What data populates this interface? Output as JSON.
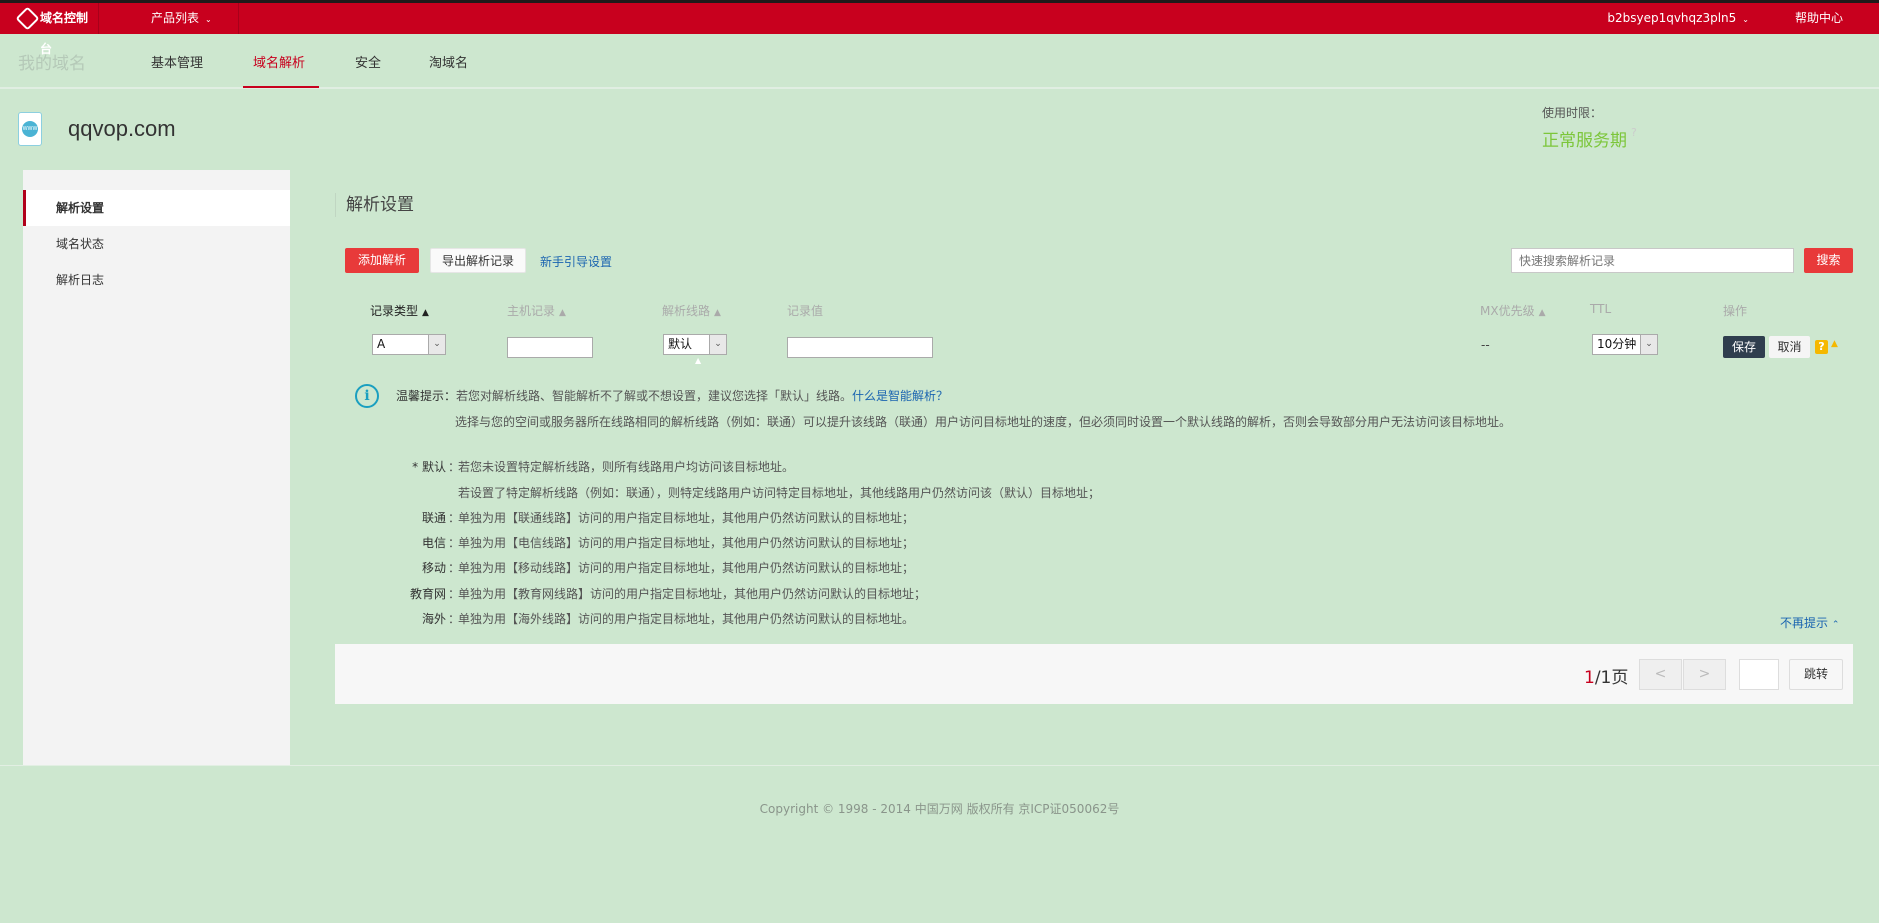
{
  "topbar": {
    "logo": "域名控制台",
    "products": "产品列表",
    "user": "b2bsyep1qvhqz3pln5",
    "help": "帮助中心"
  },
  "subnav": {
    "title": "我的域名",
    "items": [
      "基本管理",
      "域名解析",
      "安全",
      "淘域名"
    ],
    "active": "域名解析"
  },
  "domain": {
    "name": "qqvop.com",
    "usage_label": "使用时限：",
    "usage_status": "正常服务期"
  },
  "sidebar": {
    "items": [
      {
        "label": "解析设置",
        "active": true
      },
      {
        "label": "域名状态"
      },
      {
        "label": "解析日志"
      }
    ]
  },
  "main": {
    "title": "解析设置",
    "add_button": "添加解析",
    "export_button": "导出解析记录",
    "guide_link": "新手引导设置",
    "search_placeholder": "快速搜索解析记录",
    "search_button": "搜索",
    "columns": [
      "记录类型",
      "主机记录",
      "解析线路",
      "记录值",
      "MX优先级",
      "TTL",
      "操作"
    ],
    "row": {
      "type": "A",
      "host": "",
      "line": "默认",
      "value": "",
      "mx": "--",
      "ttl": "10分钟",
      "save": "保存",
      "cancel": "取消",
      "help": "?"
    }
  },
  "tips": {
    "label": "温馨提示：",
    "line1": "若您对解析线路、智能解析不了解或不想设置，建议您选择「默认」线路。",
    "line1_link": "什么是智能解析？",
    "line2": "选择与您的空间或服务器所在线路相同的解析线路（例如：联通）可以提升该线路（联通）用户访问目标地址的速度，但必须同时设置一个默认线路的解析，否则会导致部分用户无法访问该目标地址。",
    "lines": [
      {
        "label": "* 默认",
        "text": "若您未设置特定解析线路，则所有线路用户均访问该目标地址。"
      },
      {
        "label": "",
        "text": "若设置了特定解析线路（例如：联通），则特定线路用户访问特定目标地址，其他线路用户仍然访问该（默认）目标地址；"
      },
      {
        "label": "联通",
        "text": "单独为用【联通线路】访问的用户指定目标地址，其他用户仍然访问默认的目标地址；"
      },
      {
        "label": "电信",
        "text": "单独为用【电信线路】访问的用户指定目标地址，其他用户仍然访问默认的目标地址；"
      },
      {
        "label": "移动",
        "text": "单独为用【移动线路】访问的用户指定目标地址，其他用户仍然访问默认的目标地址；"
      },
      {
        "label": "教育网",
        "text": "单独为用【教育网线路】访问的用户指定目标地址，其他用户仍然访问默认的目标地址；"
      },
      {
        "label": "海外",
        "text": "单独为用【海外线路】访问的用户指定目标地址，其他用户仍然访问默认的目标地址。"
      }
    ],
    "dismiss": "不再提示"
  },
  "pager": {
    "current": "1",
    "total": "/1页",
    "prev": "<",
    "next": ">",
    "jump": "跳转"
  },
  "footer": {
    "copyright": "Copyright © 1998 - 2014 中国万网 版权所有 京ICP证050062号"
  },
  "colors": {
    "brand": "#c8001e",
    "primary_button": "#e83a3a",
    "status_green": "#7cc63a",
    "link": "#1a64b0"
  }
}
